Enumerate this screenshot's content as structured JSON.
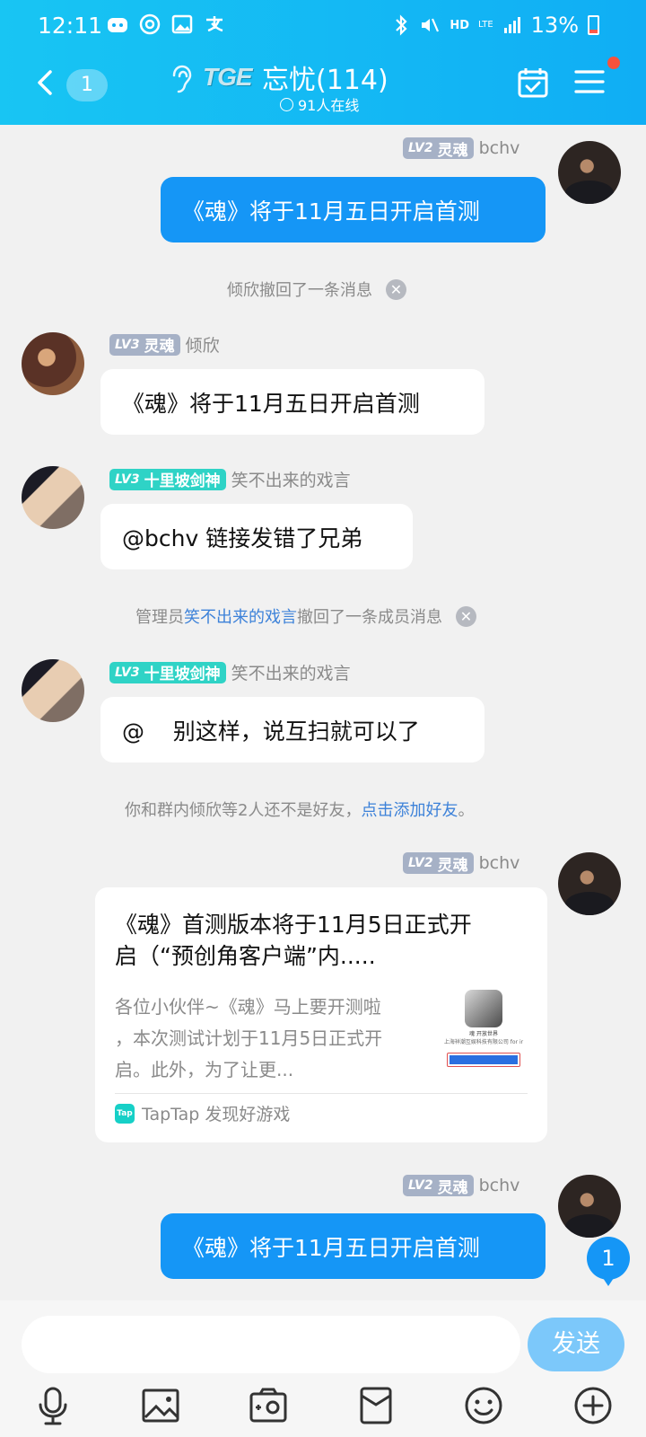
{
  "status_bar": {
    "time": "12:11",
    "battery": "13%",
    "hd": "HD",
    "network": "LTE"
  },
  "header": {
    "unread_count": "1",
    "logo_text": "TGE",
    "group_name": "忘忧(114)",
    "online_text": "91人在线"
  },
  "messages": [
    {
      "type": "chat",
      "side": "right",
      "level": "LV2",
      "title": "灵魂",
      "sender": "bchv",
      "text": "《魂》将于11月五日开启首测"
    },
    {
      "type": "system",
      "text": "倾欣撤回了一条消息"
    },
    {
      "type": "chat",
      "side": "left",
      "level": "LV3",
      "title": "灵魂",
      "sender": "倾欣",
      "text": "《魂》将于11月五日开启首测"
    },
    {
      "type": "chat",
      "side": "left",
      "level": "LV3",
      "title": "十里坡剑神",
      "sender": "笑不出来的戏言",
      "text": "@bchv 链接发错了兄弟"
    },
    {
      "type": "system",
      "prefix": "管理员",
      "link": "笑不出来的戏言",
      "suffix": "撤回了一条成员消息"
    },
    {
      "type": "chat",
      "side": "left",
      "level": "LV3",
      "title": "十里坡剑神",
      "sender": "笑不出来的戏言",
      "text": "@    别这样，说互扫就可以了"
    },
    {
      "type": "system",
      "prefix": "你和群内倾欣等2人还不是好友，",
      "link": "点击添加好友",
      "suffix": "。"
    },
    {
      "type": "card",
      "side": "right",
      "level": "LV2",
      "title": "灵魂",
      "sender": "bchv",
      "card_title_1": "《魂》首测版本将于11月5日正式开",
      "card_title_2": "启（“预创角客户端”内.....",
      "card_desc_1": "各位小伙伴~《魂》马上要开测啦",
      "card_desc_2": "，本次测试计划于11月5日正式开",
      "card_desc_3": "启。此外，为了让更...",
      "source": "TapTap 发现好游戏",
      "thumb_line1": "魂 开放世界",
      "thumb_line2": "上海祥潮互娱科技有限公司 for ir"
    },
    {
      "type": "chat",
      "side": "right",
      "level": "LV2",
      "title": "灵魂",
      "sender": "bchv",
      "text": "《魂》将于11月五日开启首测"
    }
  ],
  "new_message_badge": "1",
  "input": {
    "placeholder": "",
    "send_label": "发送"
  },
  "toolbar": [
    "microphone-icon",
    "image-icon",
    "camera-icon",
    "red-packet-icon",
    "emoji-icon",
    "plus-icon"
  ],
  "colors": {
    "header": "#10aef4",
    "self_bubble": "#1596f6",
    "link": "#3d82d9",
    "lv_gray": "#a6b1c6",
    "lv_teal": "#2fd3c6"
  }
}
